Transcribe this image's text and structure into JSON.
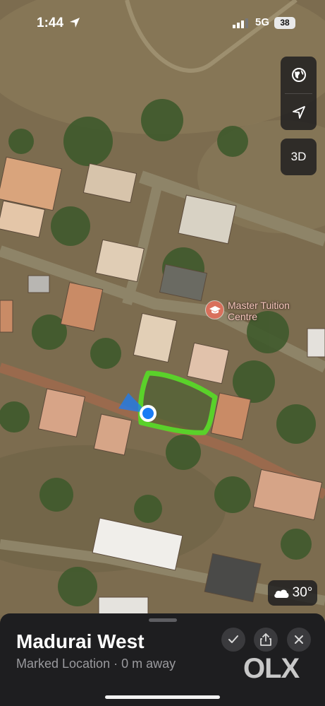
{
  "status_bar": {
    "time": "1:44",
    "network": "5G",
    "battery": "38"
  },
  "map_controls": {
    "globe_icon": "globe-icon",
    "location_icon": "location-arrow-icon",
    "view_3d": "3D"
  },
  "poi": {
    "label_line1": "Master Tuition",
    "label_line2": "Centre",
    "icon": "graduation-cap-icon"
  },
  "weather": {
    "icon": "cloud-icon",
    "temperature": "30°"
  },
  "place_sheet": {
    "title": "Madurai West",
    "subtitle": "Marked Location · 0 m away"
  },
  "watermark": "OLX",
  "colors": {
    "marked_outline": "#5ad12a",
    "user_dot": "#1a7cf5",
    "poi": "#d9705c"
  }
}
